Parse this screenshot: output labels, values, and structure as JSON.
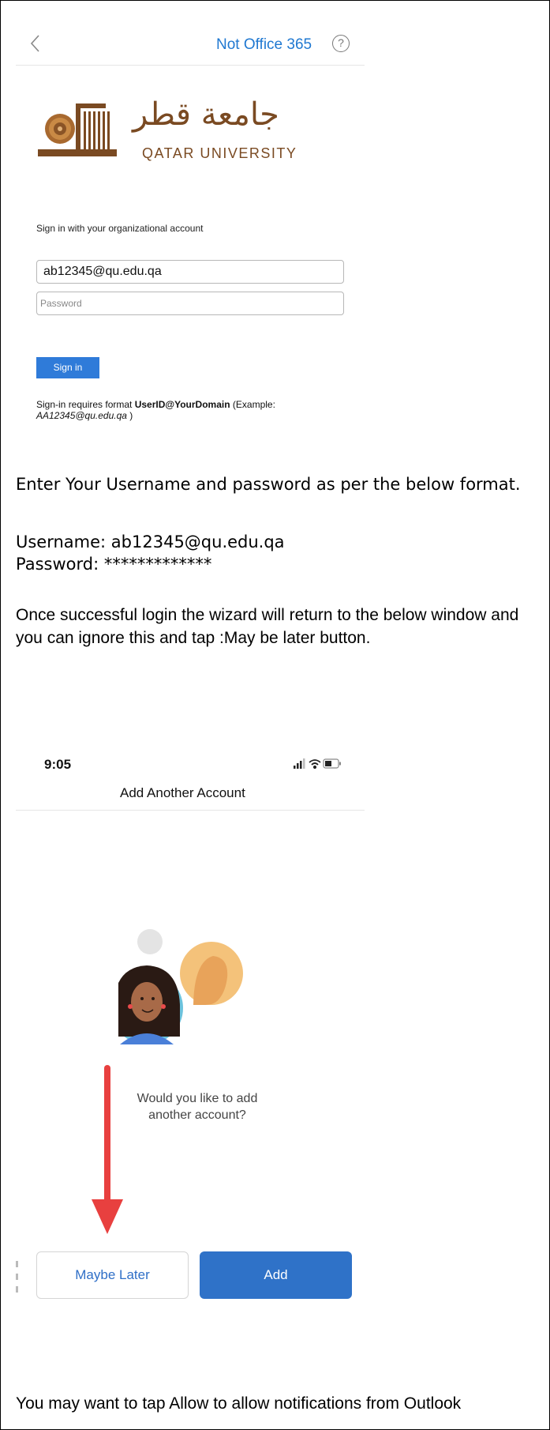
{
  "signin_screen": {
    "nav_title": "Not Office 365",
    "help_icon": "?",
    "logo_ar": "جامعة قطر",
    "logo_en": "QATAR UNIVERSITY",
    "heading": "Sign in with your organizational account",
    "username_value": "ab12345@qu.edu.qa",
    "password_placeholder": "Password",
    "signin_label": "Sign in",
    "note_prefix": "Sign-in requires format ",
    "note_bold": "UserID@YourDomain",
    "note_mid": " (Example: ",
    "note_example": "AA12345@qu.edu.qa",
    "note_suffix": " )",
    "icons": [
      "back-chevron-icon",
      "help-circle-icon",
      "qatar-university-logo"
    ],
    "accent_color": "#2f7bd9"
  },
  "instructions": {
    "p1": "Enter Your Username and password as per the below format.",
    "p2_line1": "Username: ab12345@qu.edu.qa",
    "p2_line2": "Password: *************",
    "p3": "Once successful login the wizard will return to the below window and you can ignore this and tap :May be later button.",
    "p4": "You may want to tap Allow to allow notifications from Outlook"
  },
  "add_account_screen": {
    "time": "9:05",
    "title": "Add Another Account",
    "prompt_line1": "Would you like to add",
    "prompt_line2": "another account?",
    "maybe_later_label": "Maybe Later",
    "add_label": "Add",
    "icons": [
      "cellular-signal-icon",
      "wifi-icon",
      "battery-icon",
      "avatar-illustration",
      "red-down-arrow-icon"
    ],
    "button_color": "#2f72c8",
    "arrow_color": "#e8403f"
  }
}
